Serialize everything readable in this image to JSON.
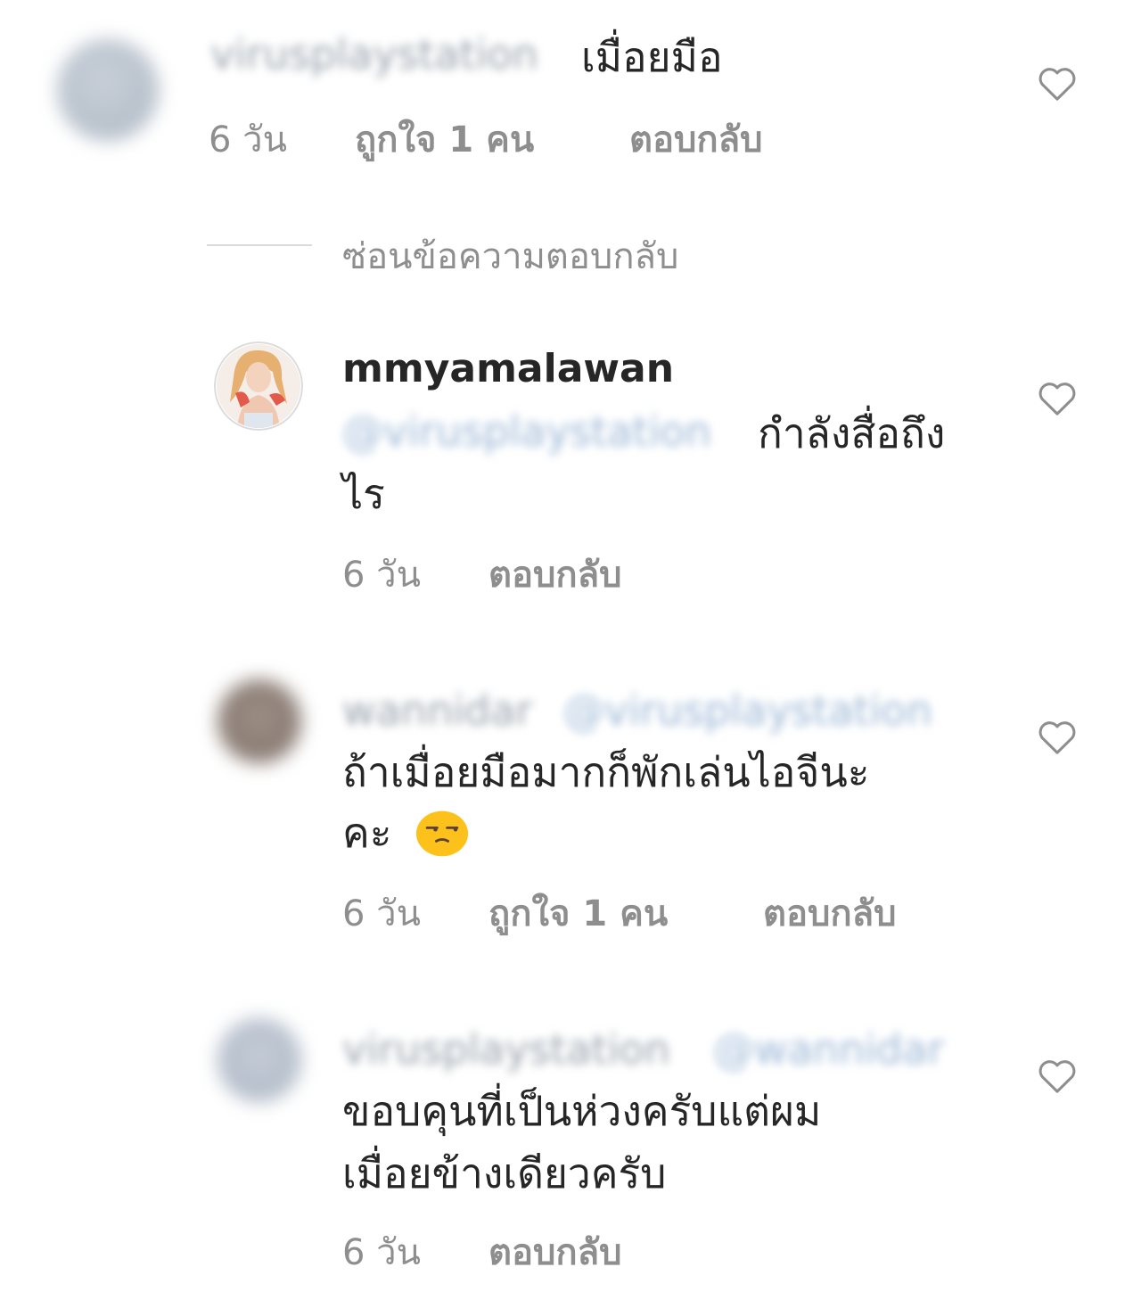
{
  "comments": [
    {
      "username": "virusplaystation",
      "text": "เมื่อยมือ",
      "time": "6 วัน",
      "likes": "ถูกใจ 1 คน",
      "reply": "ตอบกลับ"
    },
    {
      "username": "mmyamalawan",
      "mention": "@virusplaystation",
      "text_line1": "กำลังสื่อถึง",
      "text_line2": "ไร",
      "time": "6 วัน",
      "reply": "ตอบกลับ"
    },
    {
      "username": "wannidar",
      "mention": "@virusplaystation",
      "text_line1": "ถ้าเมื่อยมือมากก็พักเล่นไอจีนะ",
      "text_line2": "คะ",
      "time": "6 วัน",
      "likes": "ถูกใจ 1 คน",
      "reply": "ตอบกลับ"
    },
    {
      "username": "virusplaystation",
      "mention": "@wannidar",
      "text_line1": "ขอบคุนที่เป็นห่วงครับแต่ผม",
      "text_line2": "เมื่อยข้างเดียวครับ",
      "time": "6 วัน",
      "reply": "ตอบกลับ"
    }
  ],
  "hide_replies": "ซ่อนข้อความตอบกลับ",
  "colors": {
    "text": "#262626",
    "secondary": "#8e8e8e",
    "divider": "#dbdbdb",
    "heart": "#8e8e8e"
  }
}
